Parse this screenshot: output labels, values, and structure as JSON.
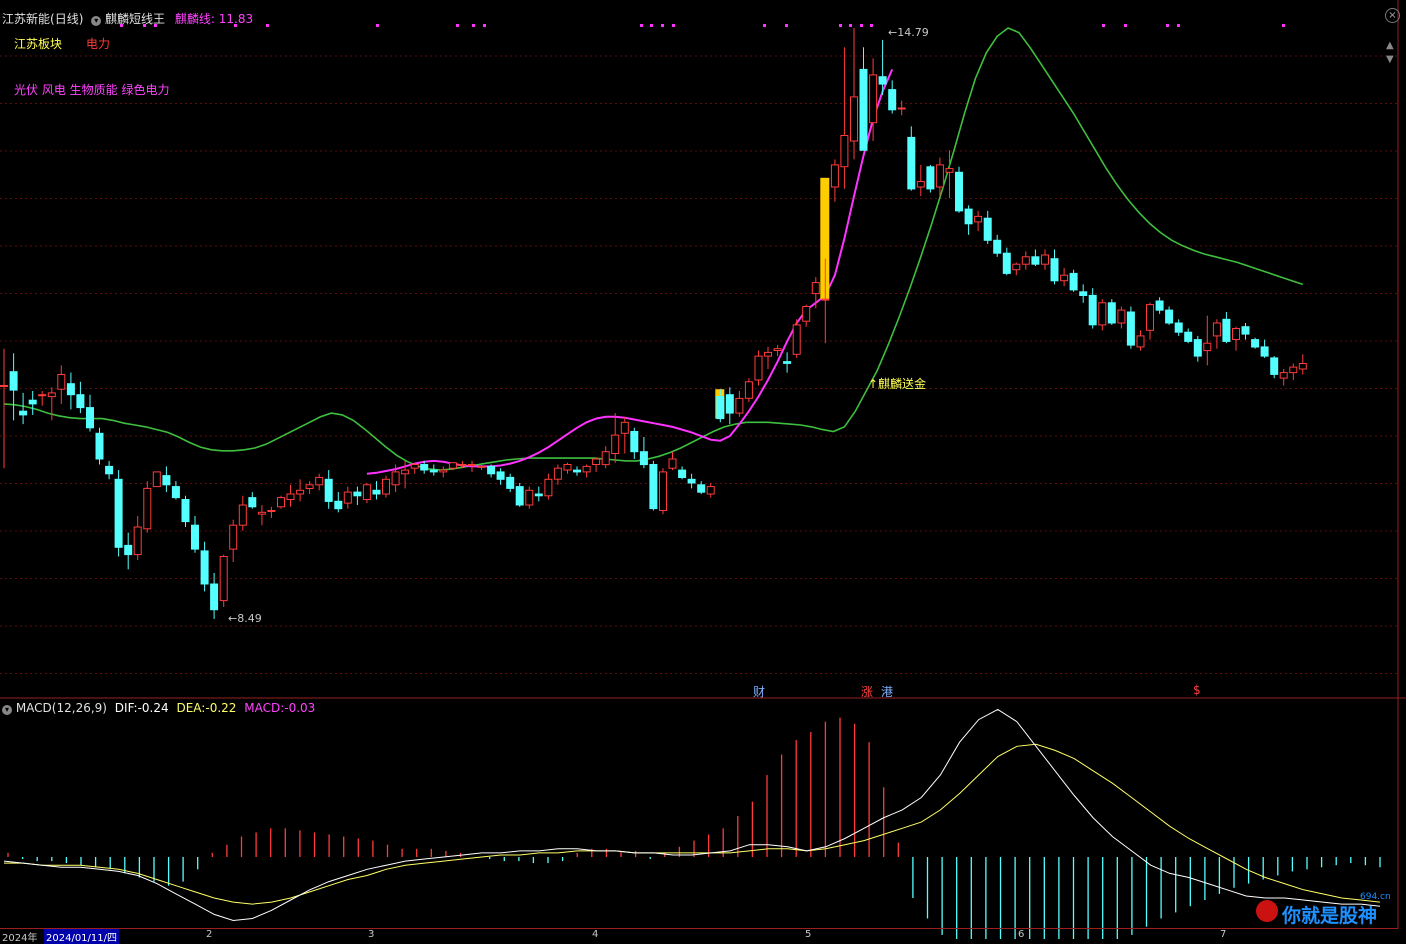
{
  "header": {
    "stock_name": "江苏新能",
    "period": "(日线)",
    "indicator_name": "麒麟短线王",
    "indicator_line_label": "麒麟线:",
    "indicator_line_value": "11.83"
  },
  "info": {
    "sector_label": "江苏板块",
    "industry_label": "电力",
    "concepts": "光伏 风电 生物质能 绿色电力"
  },
  "annotations": {
    "high_price": "14.79",
    "low_price": "8.49",
    "signal_text": "↑麒麟送金",
    "event_cai": "财",
    "event_zhang": "涨",
    "event_gang": "港",
    "event_dollar": "$"
  },
  "macd": {
    "label": "MACD(12,26,9)",
    "dif_label": "DIF:",
    "dif_value": "-0.24",
    "dea_label": "DEA:",
    "dea_value": "-0.22",
    "macd_label": "MACD:",
    "macd_value": "-0.03"
  },
  "x_axis": {
    "start_year": "2024年",
    "cursor_date": "2024/01/11/四",
    "month_ticks": [
      "2",
      "3",
      "4",
      "5",
      "6",
      "7"
    ]
  },
  "watermark": {
    "text": "你就是股神",
    "site": "694.cn"
  },
  "colors": {
    "up": "#ff3b3b",
    "down": "#54ffff",
    "ma_green": "#3fbf3f",
    "kirin_magenta": "#ff33ff",
    "signal_yellow": "#ffcc00",
    "dif_white": "#ffffff",
    "dea_yellow": "#ffff66"
  },
  "chart_data": {
    "type": "candlestick",
    "price_high": 14.79,
    "price_low": 8.49,
    "candles": [
      [
        10.9,
        11.3,
        10.0,
        10.9
      ],
      [
        11.05,
        11.25,
        10.52,
        10.85
      ],
      [
        10.62,
        10.82,
        10.48,
        10.58
      ],
      [
        10.74,
        10.84,
        10.58,
        10.7
      ],
      [
        10.8,
        10.84,
        10.68,
        10.8
      ],
      [
        10.78,
        10.88,
        10.52,
        10.82
      ],
      [
        10.86,
        11.12,
        10.7,
        11.02
      ],
      [
        10.92,
        11.04,
        10.64,
        10.8
      ],
      [
        10.8,
        10.94,
        10.6,
        10.66
      ],
      [
        10.66,
        10.8,
        10.4,
        10.44
      ],
      [
        10.38,
        10.44,
        10.04,
        10.1
      ],
      [
        10.02,
        10.08,
        9.88,
        9.94
      ],
      [
        9.88,
        9.98,
        9.04,
        9.14
      ],
      [
        9.16,
        9.3,
        8.9,
        9.06
      ],
      [
        9.06,
        9.48,
        9.0,
        9.36
      ],
      [
        9.34,
        9.86,
        9.3,
        9.78
      ],
      [
        9.8,
        9.96,
        9.8,
        9.96
      ],
      [
        9.92,
        10.02,
        9.74,
        9.82
      ],
      [
        9.8,
        9.86,
        9.66,
        9.68
      ],
      [
        9.66,
        9.7,
        9.36,
        9.42
      ],
      [
        9.38,
        9.48,
        9.08,
        9.12
      ],
      [
        9.1,
        9.2,
        8.66,
        8.74
      ],
      [
        8.74,
        8.86,
        8.36,
        8.46
      ],
      [
        8.56,
        9.06,
        8.49,
        9.04
      ],
      [
        9.12,
        9.44,
        8.98,
        9.38
      ],
      [
        9.38,
        9.7,
        9.32,
        9.6
      ],
      [
        9.68,
        9.74,
        9.56,
        9.58
      ],
      [
        9.5,
        9.6,
        9.38,
        9.52
      ],
      [
        9.54,
        9.58,
        9.46,
        9.54
      ],
      [
        9.58,
        9.7,
        9.56,
        9.68
      ],
      [
        9.66,
        9.82,
        9.58,
        9.72
      ],
      [
        9.72,
        9.88,
        9.64,
        9.76
      ],
      [
        9.78,
        9.86,
        9.72,
        9.82
      ],
      [
        9.82,
        9.94,
        9.76,
        9.9
      ],
      [
        9.88,
        9.98,
        9.56,
        9.64
      ],
      [
        9.64,
        9.74,
        9.52,
        9.56
      ],
      [
        9.62,
        9.8,
        9.56,
        9.74
      ],
      [
        9.74,
        9.8,
        9.6,
        9.7
      ],
      [
        9.66,
        9.84,
        9.62,
        9.82
      ],
      [
        9.76,
        9.86,
        9.66,
        9.72
      ],
      [
        9.72,
        9.92,
        9.68,
        9.88
      ],
      [
        9.82,
        10.04,
        9.74,
        9.96
      ],
      [
        9.94,
        10.08,
        9.78,
        9.98
      ],
      [
        10.0,
        10.06,
        9.94,
        10.04
      ],
      [
        10.04,
        10.08,
        9.94,
        9.98
      ],
      [
        9.98,
        10.04,
        9.92,
        9.96
      ],
      [
        9.96,
        10.02,
        9.9,
        9.98
      ],
      [
        10.0,
        10.06,
        9.98,
        10.06
      ],
      [
        10.04,
        10.08,
        10.0,
        10.04
      ],
      [
        10.04,
        10.08,
        9.96,
        10.04
      ],
      [
        10.02,
        10.06,
        9.98,
        10.02
      ],
      [
        10.02,
        10.04,
        9.9,
        9.94
      ],
      [
        9.96,
        10.0,
        9.82,
        9.88
      ],
      [
        9.9,
        9.94,
        9.74,
        9.78
      ],
      [
        9.8,
        9.84,
        9.58,
        9.6
      ],
      [
        9.6,
        9.8,
        9.56,
        9.76
      ],
      [
        9.72,
        9.8,
        9.64,
        9.7
      ],
      [
        9.7,
        9.94,
        9.66,
        9.88
      ],
      [
        9.88,
        10.04,
        9.82,
        10.0
      ],
      [
        9.98,
        10.06,
        9.94,
        10.04
      ],
      [
        9.98,
        10.02,
        9.92,
        9.96
      ],
      [
        9.96,
        10.04,
        9.9,
        10.02
      ],
      [
        10.04,
        10.12,
        9.96,
        10.1
      ],
      [
        10.04,
        10.24,
        10.0,
        10.18
      ],
      [
        10.16,
        10.6,
        10.06,
        10.36
      ],
      [
        10.38,
        10.56,
        10.16,
        10.5
      ],
      [
        10.4,
        10.44,
        10.1,
        10.18
      ],
      [
        10.18,
        10.34,
        10.0,
        10.04
      ],
      [
        10.04,
        10.08,
        9.54,
        9.56
      ],
      [
        9.54,
        10.0,
        9.5,
        9.96
      ],
      [
        10.0,
        10.18,
        9.98,
        10.1
      ],
      [
        9.98,
        10.02,
        9.88,
        9.9
      ],
      [
        9.88,
        9.94,
        9.78,
        9.84
      ],
      [
        9.82,
        9.86,
        9.72,
        9.74
      ],
      [
        9.72,
        9.84,
        9.68,
        9.8
      ],
      [
        10.78,
        10.86,
        10.5,
        10.54
      ],
      [
        10.8,
        10.88,
        10.48,
        10.6
      ],
      [
        10.6,
        10.84,
        10.56,
        10.76
      ],
      [
        10.76,
        10.98,
        10.72,
        10.94
      ],
      [
        10.96,
        11.28,
        10.9,
        11.22
      ],
      [
        11.22,
        11.32,
        11.08,
        11.26
      ],
      [
        11.28,
        11.34,
        11.22,
        11.3
      ],
      [
        11.16,
        11.26,
        11.04,
        11.14
      ],
      [
        11.24,
        11.62,
        11.2,
        11.56
      ],
      [
        11.6,
        11.78,
        11.54,
        11.76
      ],
      [
        11.9,
        12.08,
        11.74,
        12.02
      ],
      [
        11.84,
        12.28,
        11.36,
        11.84
      ],
      [
        13.06,
        13.36,
        12.9,
        13.3
      ],
      [
        13.28,
        14.58,
        13.04,
        13.62
      ],
      [
        13.56,
        14.79,
        13.36,
        14.04
      ],
      [
        14.34,
        14.58,
        13.46,
        13.46
      ],
      [
        13.76,
        14.46,
        13.56,
        14.28
      ],
      [
        14.26,
        14.66,
        14.06,
        14.18
      ],
      [
        14.12,
        14.22,
        13.86,
        13.9
      ],
      [
        13.92,
        14.0,
        13.84,
        13.92
      ],
      [
        13.6,
        13.72,
        13.02,
        13.04
      ],
      [
        13.06,
        13.3,
        12.96,
        13.12
      ],
      [
        13.28,
        13.3,
        13.0,
        13.04
      ],
      [
        13.06,
        13.38,
        12.96,
        13.3
      ],
      [
        13.22,
        13.46,
        12.94,
        13.26
      ],
      [
        13.22,
        13.28,
        12.78,
        12.8
      ],
      [
        12.82,
        12.86,
        12.54,
        12.66
      ],
      [
        12.68,
        12.8,
        12.58,
        12.74
      ],
      [
        12.72,
        12.8,
        12.44,
        12.48
      ],
      [
        12.48,
        12.54,
        12.3,
        12.34
      ],
      [
        12.34,
        12.4,
        12.1,
        12.12
      ],
      [
        12.16,
        12.24,
        12.1,
        12.22
      ],
      [
        12.22,
        12.36,
        12.16,
        12.3
      ],
      [
        12.3,
        12.38,
        12.2,
        12.22
      ],
      [
        12.22,
        12.38,
        12.16,
        12.32
      ],
      [
        12.28,
        12.38,
        12.0,
        12.04
      ],
      [
        12.04,
        12.18,
        11.98,
        12.1
      ],
      [
        12.12,
        12.16,
        11.92,
        11.94
      ],
      [
        11.92,
        12.0,
        11.8,
        11.88
      ],
      [
        11.88,
        11.96,
        11.52,
        11.56
      ],
      [
        11.56,
        11.84,
        11.5,
        11.8
      ],
      [
        11.8,
        11.84,
        11.56,
        11.58
      ],
      [
        11.58,
        11.76,
        11.52,
        11.72
      ],
      [
        11.7,
        11.76,
        11.3,
        11.34
      ],
      [
        11.32,
        11.5,
        11.28,
        11.44
      ],
      [
        11.5,
        11.8,
        11.4,
        11.78
      ],
      [
        11.82,
        11.86,
        11.68,
        11.72
      ],
      [
        11.72,
        11.76,
        11.56,
        11.58
      ],
      [
        11.58,
        11.62,
        11.44,
        11.48
      ],
      [
        11.48,
        11.52,
        11.36,
        11.38
      ],
      [
        11.4,
        11.44,
        11.16,
        11.22
      ],
      [
        11.28,
        11.66,
        11.12,
        11.36
      ],
      [
        11.44,
        11.62,
        11.3,
        11.58
      ],
      [
        11.62,
        11.7,
        11.36,
        11.38
      ],
      [
        11.4,
        11.54,
        11.28,
        11.52
      ],
      [
        11.54,
        11.58,
        11.4,
        11.46
      ],
      [
        11.4,
        11.42,
        11.3,
        11.32
      ],
      [
        11.32,
        11.4,
        11.2,
        11.22
      ],
      [
        11.2,
        11.22,
        10.98,
        11.02
      ],
      [
        10.98,
        11.08,
        10.9,
        11.04
      ],
      [
        11.04,
        11.14,
        10.96,
        11.1
      ],
      [
        11.08,
        11.24,
        11.02,
        11.14
      ]
    ],
    "green_ma": [
      10.7,
      10.69,
      10.67,
      10.64,
      10.6,
      10.57,
      10.55,
      10.54,
      10.54,
      10.54,
      10.52,
      10.49,
      10.47,
      10.45,
      10.42,
      10.39,
      10.34,
      10.28,
      10.23,
      10.2,
      10.19,
      10.19,
      10.2,
      10.22,
      10.26,
      10.32,
      10.38,
      10.44,
      10.5,
      10.56,
      10.6,
      10.58,
      10.52,
      10.43,
      10.33,
      10.23,
      10.14,
      10.07,
      10.02,
      9.99,
      9.98,
      9.99,
      10.01,
      10.03,
      10.05,
      10.07,
      10.09,
      10.1,
      10.11,
      10.11,
      10.11,
      10.11,
      10.11,
      10.11,
      10.11,
      10.1,
      10.09,
      10.08,
      10.08,
      10.1,
      10.13,
      10.17,
      10.22,
      10.28,
      10.34,
      10.4,
      10.45,
      10.48,
      10.5,
      10.5,
      10.5,
      10.49,
      10.48,
      10.47,
      10.45,
      10.42,
      10.4,
      10.45,
      10.62,
      10.84,
      11.06,
      11.34,
      11.64,
      11.96,
      12.3,
      12.66,
      13.04,
      13.44,
      13.86,
      14.24,
      14.52,
      14.7,
      14.79,
      14.74,
      14.58,
      14.4,
      14.22,
      14.04,
      13.86,
      13.66,
      13.46,
      13.26,
      13.08,
      12.92,
      12.78,
      12.66,
      12.56,
      12.48,
      12.42,
      12.37,
      12.33,
      12.3,
      12.27,
      12.24,
      12.2,
      12.16,
      12.12,
      12.08,
      12.04,
      12.0
    ],
    "kirin_line": {
      "start_index": 38,
      "values": [
        9.94,
        9.95,
        9.97,
        9.99,
        10.02,
        10.05,
        10.07,
        10.08,
        10.07,
        10.05,
        10.03,
        10.02,
        10.02,
        10.02,
        10.03,
        10.05,
        10.08,
        10.12,
        10.17,
        10.23,
        10.3,
        10.37,
        10.44,
        10.5,
        10.54,
        10.56,
        10.56,
        10.55,
        10.53,
        10.51,
        10.49,
        10.47,
        10.45,
        10.42,
        10.39,
        10.35,
        10.31,
        10.3,
        10.35,
        10.48,
        10.62,
        10.78,
        10.96,
        11.16,
        11.38,
        11.58,
        11.72,
        11.8,
        11.88,
        12.1,
        12.5,
        12.96,
        13.4,
        13.8,
        14.1,
        14.34
      ]
    },
    "buy_bars": [
      {
        "index": 75,
        "from": 10.54,
        "to": 10.86
      },
      {
        "index": 86,
        "from": 11.84,
        "to": 13.16
      }
    ],
    "macd": {
      "dif": [
        -0.02,
        -0.03,
        -0.04,
        -0.05,
        -0.05,
        -0.06,
        -0.07,
        -0.09,
        -0.13,
        -0.18,
        -0.23,
        -0.28,
        -0.31,
        -0.3,
        -0.26,
        -0.21,
        -0.16,
        -0.12,
        -0.09,
        -0.06,
        -0.04,
        -0.02,
        -0.01,
        0.0,
        0.01,
        0.02,
        0.02,
        0.03,
        0.03,
        0.04,
        0.04,
        0.03,
        0.03,
        0.02,
        0.02,
        0.01,
        0.01,
        0.02,
        0.03,
        0.06,
        0.06,
        0.05,
        0.03,
        0.05,
        0.09,
        0.14,
        0.19,
        0.23,
        0.29,
        0.4,
        0.56,
        0.67,
        0.72,
        0.66,
        0.54,
        0.42,
        0.3,
        0.19,
        0.1,
        0.03,
        -0.04,
        -0.08,
        -0.1,
        -0.13,
        -0.16,
        -0.19,
        -0.2,
        -0.2,
        -0.21,
        -0.22,
        -0.23,
        -0.23,
        -0.24
      ],
      "dea": [
        -0.03,
        -0.03,
        -0.04,
        -0.04,
        -0.04,
        -0.05,
        -0.06,
        -0.08,
        -0.11,
        -0.14,
        -0.17,
        -0.2,
        -0.22,
        -0.23,
        -0.22,
        -0.2,
        -0.17,
        -0.14,
        -0.11,
        -0.09,
        -0.06,
        -0.04,
        -0.03,
        -0.02,
        -0.01,
        0.0,
        0.01,
        0.01,
        0.02,
        0.02,
        0.03,
        0.03,
        0.03,
        0.02,
        0.02,
        0.02,
        0.02,
        0.02,
        0.02,
        0.03,
        0.04,
        0.04,
        0.03,
        0.04,
        0.06,
        0.08,
        0.11,
        0.14,
        0.17,
        0.23,
        0.31,
        0.4,
        0.49,
        0.54,
        0.55,
        0.52,
        0.48,
        0.42,
        0.36,
        0.29,
        0.22,
        0.15,
        0.09,
        0.04,
        -0.01,
        -0.06,
        -0.1,
        -0.13,
        -0.16,
        -0.18,
        -0.2,
        -0.21,
        -0.22
      ],
      "hist": [
        0.02,
        -0.01,
        -0.02,
        -0.02,
        -0.03,
        -0.04,
        -0.05,
        -0.06,
        -0.08,
        -0.1,
        -0.12,
        -0.14,
        -0.12,
        -0.06,
        0.02,
        0.06,
        0.1,
        0.12,
        0.14,
        0.14,
        0.13,
        0.12,
        0.11,
        0.1,
        0.09,
        0.08,
        0.06,
        0.04,
        0.04,
        0.04,
        0.03,
        0.02,
        0.0,
        -0.01,
        -0.02,
        -0.02,
        -0.03,
        -0.03,
        -0.02,
        0.02,
        0.04,
        0.04,
        0.03,
        0.03,
        -0.01,
        0.02,
        0.05,
        0.08,
        0.11,
        0.14,
        0.2,
        0.27,
        0.4,
        0.5,
        0.57,
        0.61,
        0.66,
        0.68,
        0.65,
        0.56,
        0.34,
        0.07,
        -0.2,
        -0.3,
        -0.38,
        -0.46,
        -0.5,
        -0.54,
        -0.58,
        -0.58,
        -0.57,
        -0.56,
        -0.54,
        -0.52,
        -0.49,
        -0.46,
        -0.42,
        -0.38,
        -0.34,
        -0.3,
        -0.27,
        -0.24,
        -0.21,
        -0.18,
        -0.15,
        -0.13,
        -0.11,
        -0.09,
        -0.07,
        -0.06,
        -0.05,
        -0.04,
        -0.03,
        -0.04,
        -0.05
      ]
    }
  }
}
